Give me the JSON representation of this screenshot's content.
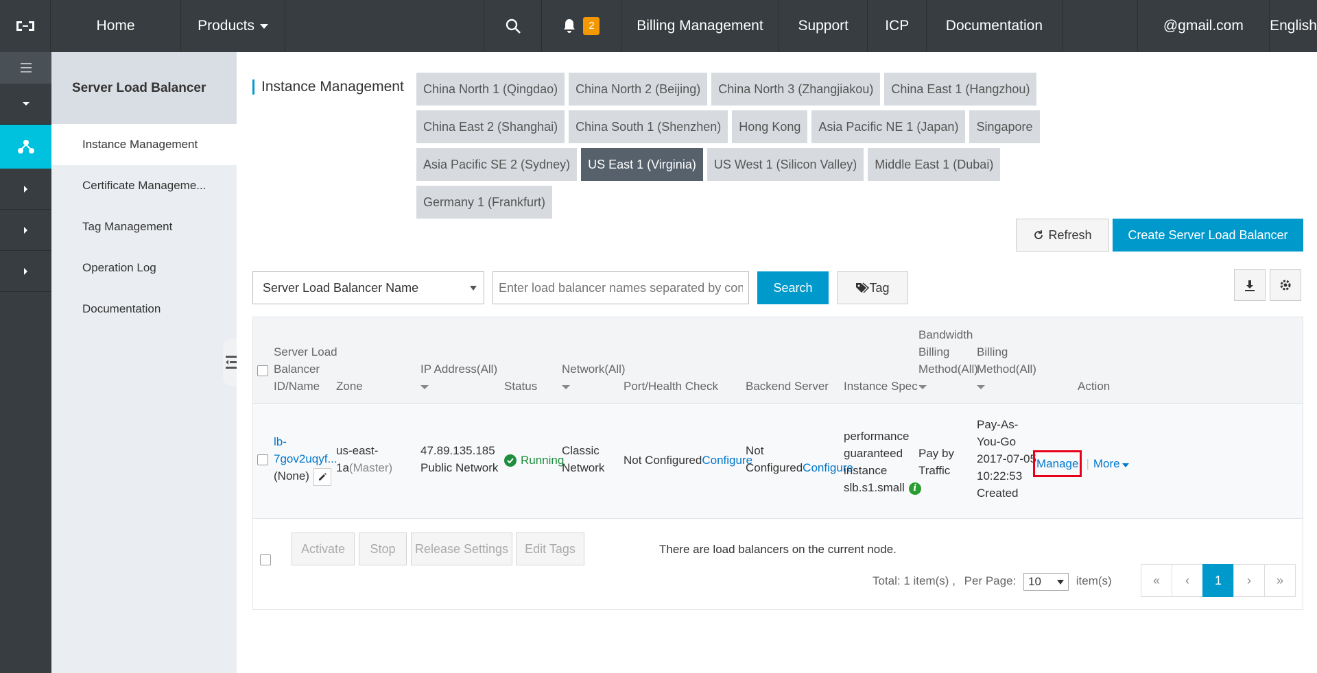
{
  "topnav": {
    "home": "Home",
    "products": "Products",
    "notification_count": "2",
    "billing": "Billing Management",
    "support": "Support",
    "icp": "ICP",
    "documentation": "Documentation",
    "account": "@gmail.com",
    "language": "English"
  },
  "sidebar": {
    "title": "Server Load Balancer",
    "items": [
      {
        "label": "Instance Management"
      },
      {
        "label": "Certificate Manageme..."
      },
      {
        "label": "Tag Management"
      },
      {
        "label": "Operation Log"
      },
      {
        "label": "Documentation"
      }
    ]
  },
  "main": {
    "title": "Instance Management",
    "regions": [
      {
        "label": "China North 1 (Qingdao)"
      },
      {
        "label": "China North 2 (Beijing)"
      },
      {
        "label": "China North 3 (Zhangjiakou)"
      },
      {
        "label": "China East 1 (Hangzhou)"
      },
      {
        "label": "China East 2 (Shanghai)"
      },
      {
        "label": "China South 1 (Shenzhen)"
      },
      {
        "label": "Hong Kong"
      },
      {
        "label": "Asia Pacific NE 1 (Japan)"
      },
      {
        "label": "Singapore"
      },
      {
        "label": "Asia Pacific SE 2 (Sydney)"
      },
      {
        "label": "US East 1 (Virginia)",
        "selected": true
      },
      {
        "label": "US West 1 (Silicon Valley)"
      },
      {
        "label": "Middle East 1 (Dubai)"
      },
      {
        "label": "Germany 1 (Frankfurt)"
      }
    ],
    "refresh_label": "Refresh",
    "create_label": "Create Server Load Balancer"
  },
  "filter": {
    "field_selected": "Server Load Balancer Name",
    "search_placeholder": "Enter load balancer names separated by con",
    "search_label": "Search",
    "tag_label": "Tag"
  },
  "table": {
    "headers": {
      "id_line1": "Server Load",
      "id_line2": "Balancer",
      "id_line3": "ID/Name",
      "zone": "Zone",
      "ip": "IP Address(All)",
      "status": "Status",
      "network": "Network(All)",
      "port": "Port/Health Check",
      "backend": "Backend Server",
      "spec": "Instance Spec",
      "bw_line1": "Bandwidth",
      "bw_line2": "Billing",
      "bw_line3": "Method(All)",
      "bill_line1": "Billing",
      "bill_line2": "Method(All)",
      "action": "Action"
    },
    "rows": [
      {
        "id_line1": "lb-",
        "id_line2": "7gov2uqyf...",
        "name": "(None)",
        "zone_line1": "us-east-",
        "zone_line2": "1a",
        "zone_suffix": "(Master)",
        "ip": "47.89.135.185",
        "ip_type": "Public Network",
        "status": "Running",
        "network_line1": "Classic",
        "network_line2": "Network",
        "port_text": "Not Configured",
        "port_link": "Configure",
        "backend_line1": "Not",
        "backend_text": "Configured",
        "backend_link": "Configure",
        "spec_line1": "performance",
        "spec_line2": "guaranteed",
        "spec_line3": "instance",
        "spec_line4": "slb.s1.small",
        "bw_line1": "Pay by",
        "bw_line2": "Traffic",
        "bill_line1": "Pay-As-",
        "bill_line2": "You-Go",
        "bill_date": "2017-07-05",
        "bill_time": "10:22:53",
        "bill_created": "Created",
        "manage": "Manage",
        "more": "More"
      }
    ]
  },
  "footer": {
    "activate": "Activate",
    "stop": "Stop",
    "release": "Release Settings",
    "edit_tags": "Edit Tags",
    "node_message": "There are load balancers on the current node.",
    "total": "Total: 1 item(s) ,",
    "per_page_label": "Per Page:",
    "per_page_value": "10",
    "items_suffix": "item(s)",
    "pager": [
      "«",
      "‹",
      "1",
      "›",
      "»"
    ],
    "current_page": "1"
  },
  "colors": {
    "topbar": "#373d41",
    "accent": "#0099cc",
    "active_sidebar_icon": "#00c1de",
    "selected_region": "#56616b",
    "badge": "#f39800",
    "running": "#1e8e3e",
    "highlight_box": "#e6001a"
  },
  "icons": [
    "aliyun-logo-icon",
    "search-icon",
    "bell-icon",
    "menu-icon",
    "load-balancer-icon",
    "refresh-icon",
    "tag-icon",
    "export-icon",
    "gear-icon",
    "edit-icon",
    "info-icon",
    "check-circle-icon"
  ]
}
